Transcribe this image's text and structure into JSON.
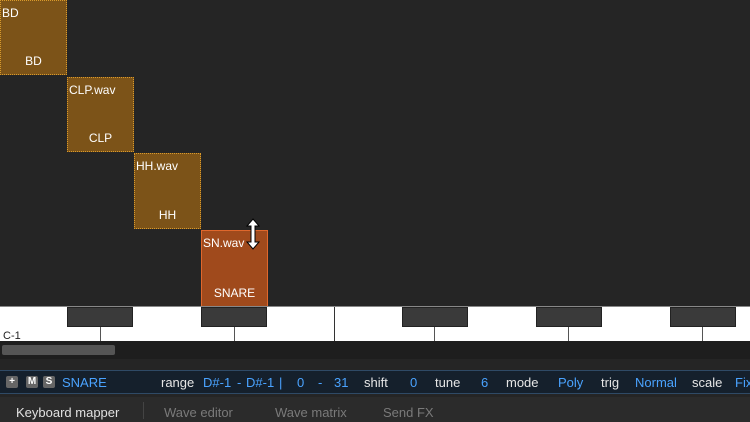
{
  "zones": [
    {
      "file": "BD",
      "label": "BD"
    },
    {
      "file": "CLP.wav",
      "label": "CLP"
    },
    {
      "file": "HH.wav",
      "label": "HH"
    },
    {
      "file": "SN.wav",
      "label": "SNARE"
    }
  ],
  "keyboard": {
    "label": "C-1"
  },
  "statusbar": {
    "add": "+",
    "mute": "M",
    "solo": "S",
    "zone_name": "SNARE",
    "range_label": "range",
    "range_low": "D#-1",
    "range_dash": "-",
    "range_high": "D#-1",
    "pipe": "|",
    "vel_low": "0",
    "vel_dash": "-",
    "vel_high": "31",
    "shift_label": "shift",
    "shift_value": "0",
    "tune_label": "tune",
    "tune_value": "6",
    "mode_label": "mode",
    "mode_value": "Poly",
    "trig_label": "trig",
    "trig_value": "Normal",
    "scale_label": "scale",
    "scale_value": "Fix"
  },
  "tabs": [
    "Keyboard mapper",
    "Wave editor",
    "Wave matrix",
    "Send FX"
  ],
  "colors": {
    "zone": "#7c5318",
    "selected_zone": "#a04a1c",
    "accent": "#4aa3ff"
  }
}
